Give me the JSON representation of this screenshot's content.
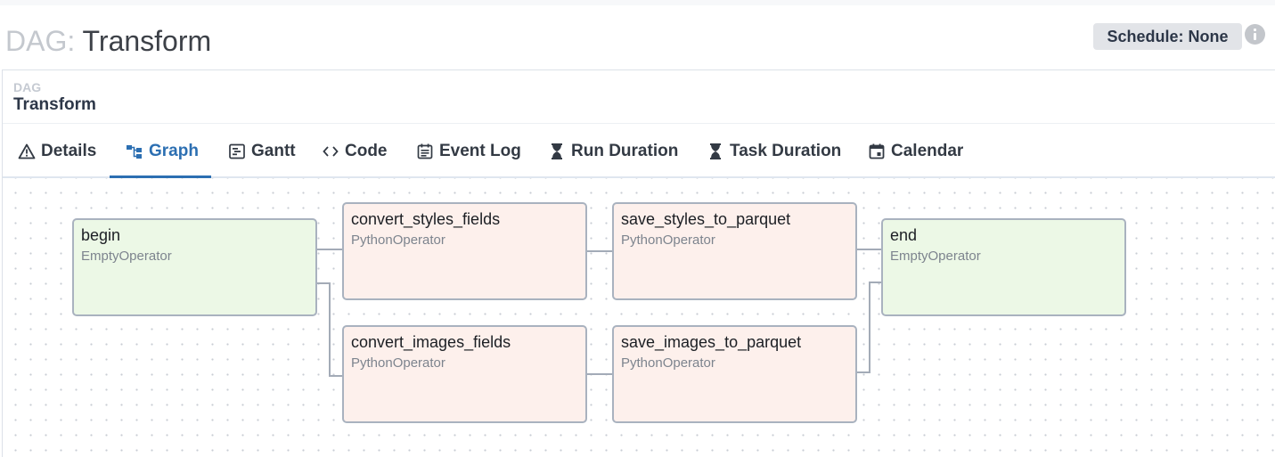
{
  "header": {
    "title_prefix": "DAG:",
    "title_name": "Transform",
    "schedule_badge": "Schedule: None",
    "info_icon": "info-icon"
  },
  "dag_panel": {
    "label": "DAG",
    "name": "Transform"
  },
  "tabs": [
    {
      "label": "Details",
      "icon": "warning-triangle-icon",
      "active": false
    },
    {
      "label": "Graph",
      "icon": "graph-icon",
      "active": true
    },
    {
      "label": "Gantt",
      "icon": "gantt-icon",
      "active": false
    },
    {
      "label": "Code",
      "icon": "code-icon",
      "active": false
    },
    {
      "label": "Event Log",
      "icon": "event-log-icon",
      "active": false
    },
    {
      "label": "Run Duration",
      "icon": "hourglass-icon",
      "active": false
    },
    {
      "label": "Task Duration",
      "icon": "hourglass-icon",
      "active": false
    },
    {
      "label": "Calendar",
      "icon": "calendar-icon",
      "active": false
    }
  ],
  "graph": {
    "nodes": [
      {
        "id": "begin",
        "operator": "EmptyOperator",
        "kind": "empty"
      },
      {
        "id": "convert_styles_fields",
        "operator": "PythonOperator",
        "kind": "python"
      },
      {
        "id": "convert_images_fields",
        "operator": "PythonOperator",
        "kind": "python"
      },
      {
        "id": "save_styles_to_parquet",
        "operator": "PythonOperator",
        "kind": "python"
      },
      {
        "id": "save_images_to_parquet",
        "operator": "PythonOperator",
        "kind": "python"
      },
      {
        "id": "end",
        "operator": "EmptyOperator",
        "kind": "empty"
      }
    ],
    "edges": [
      [
        "begin",
        "convert_styles_fields"
      ],
      [
        "begin",
        "convert_images_fields"
      ],
      [
        "convert_styles_fields",
        "save_styles_to_parquet"
      ],
      [
        "convert_images_fields",
        "save_images_to_parquet"
      ],
      [
        "save_styles_to_parquet",
        "end"
      ],
      [
        "save_images_to_parquet",
        "end"
      ]
    ],
    "colors": {
      "empty_fill": "#ecf8e6",
      "python_fill": "#fdf0ec",
      "border": "#a9b2bf",
      "edge": "#a3abb7"
    }
  },
  "colors": {
    "accent": "#2c6fb2"
  }
}
